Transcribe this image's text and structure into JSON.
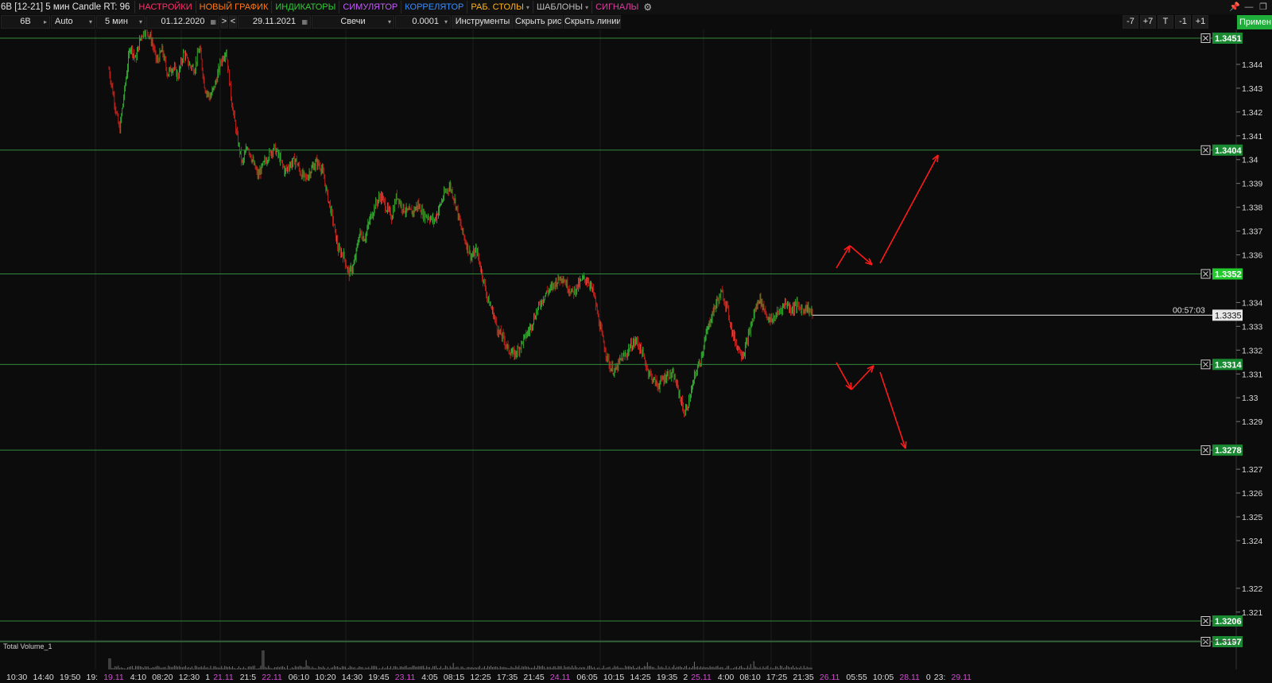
{
  "header": {
    "title": "6B [12-21] 5 мин Candle RT: 96",
    "menus": [
      {
        "label": "НАСТРОЙКИ",
        "color": "#ff2f6e"
      },
      {
        "label": "НОВЫЙ ГРАФИК",
        "color": "#ff7a1a"
      },
      {
        "label": "ИНДИКАТОРЫ",
        "color": "#34c93c"
      },
      {
        "label": "СИМУЛЯТОР",
        "color": "#c65bff"
      },
      {
        "label": "КОРРЕЛЯТОР",
        "color": "#3b8cff"
      },
      {
        "label": "РАБ. СТОЛЫ",
        "color": "#ffb01f"
      },
      {
        "label": "ШАБЛОНЫ",
        "color": "#bdbdbd"
      },
      {
        "label": "СИГНАЛЫ",
        "color": "#e03ea0"
      }
    ],
    "pin_icon": "pin-icon",
    "minimize_icon": "minimize-icon",
    "restore_icon": "restore-icon",
    "settings_icon": "gear-icon"
  },
  "toolbar": {
    "symbol": "6B",
    "scale": "Auto",
    "timeframe": "5 мин",
    "date_from": "01.12.2020",
    "nav_next": ">",
    "nav_prev": "<",
    "date_to": "29.11.2021",
    "chart_type": "Свечи",
    "step": "0.0001",
    "tools_label": "Инструменты",
    "hide_drawings_label": "Скрыть рис.",
    "hide_lines_label": "Скрыть линии",
    "zoom_buttons": [
      "-7",
      "+7",
      "T",
      "-1",
      "+1"
    ],
    "apply_label": "Примен"
  },
  "chart_data": {
    "type": "candlestick",
    "instrument": "6B [12-21]",
    "timeframe": "5 мин",
    "y_range": [
      1.3195,
      1.3455
    ],
    "y_ticks": [
      "1.344",
      "1.343",
      "1.342",
      "1.341",
      "1.34",
      "1.339",
      "1.338",
      "1.337",
      "1.336",
      "1.334",
      "1.333",
      "1.332",
      "1.331",
      "1.33",
      "1.329",
      "1.327",
      "1.326",
      "1.325",
      "1.324",
      "1.322",
      "1.321"
    ],
    "horizontal_levels": [
      {
        "value": 1.3451,
        "label": "1.3451",
        "highlight": false
      },
      {
        "value": 1.3404,
        "label": "1.3404",
        "highlight": false
      },
      {
        "value": 1.3352,
        "label": "1.3352",
        "highlight": true
      },
      {
        "value": 1.3314,
        "label": "1.3314",
        "highlight": false
      },
      {
        "value": 1.3278,
        "label": "1.3278",
        "highlight": false
      },
      {
        "value": 1.3206,
        "label": "1.3206",
        "highlight": false
      },
      {
        "value": 1.3197,
        "label": "1.3197",
        "highlight": false
      }
    ],
    "current_price": {
      "value": 1.3335,
      "label": "1.3335",
      "timer": "00:57:03"
    },
    "price_path": [
      1.3438,
      1.3425,
      1.3412,
      1.343,
      1.3448,
      1.3442,
      1.3452,
      1.3455,
      1.345,
      1.3441,
      1.3446,
      1.3436,
      1.3439,
      1.3435,
      1.3445,
      1.344,
      1.3438,
      1.3447,
      1.343,
      1.3426,
      1.3432,
      1.3441,
      1.3446,
      1.3425,
      1.341,
      1.3398,
      1.3406,
      1.3399,
      1.3393,
      1.3398,
      1.3402,
      1.3405,
      1.3401,
      1.3395,
      1.3398,
      1.34,
      1.3394,
      1.3392,
      1.3396,
      1.3399,
      1.3396,
      1.3385,
      1.3375,
      1.3362,
      1.336,
      1.3352,
      1.3356,
      1.3369,
      1.3367,
      1.3375,
      1.3381,
      1.3385,
      1.338,
      1.3376,
      1.3385,
      1.338,
      1.3378,
      1.3378,
      1.3381,
      1.3377,
      1.3376,
      1.3374,
      1.338,
      1.3386,
      1.3389,
      1.3382,
      1.3372,
      1.3365,
      1.3359,
      1.3362,
      1.3352,
      1.3342,
      1.3336,
      1.3328,
      1.3325,
      1.332,
      1.3318,
      1.3321,
      1.3325,
      1.3329,
      1.3335,
      1.334,
      1.3344,
      1.3346,
      1.3349,
      1.3351,
      1.3347,
      1.3344,
      1.3347,
      1.335,
      1.3349,
      1.3343,
      1.3331,
      1.3321,
      1.3313,
      1.3311,
      1.3316,
      1.3318,
      1.3322,
      1.3324,
      1.3319,
      1.3312,
      1.3308,
      1.3305,
      1.3308,
      1.331,
      1.3309,
      1.3302,
      1.3293,
      1.33,
      1.331,
      1.3316,
      1.3326,
      1.3334,
      1.334,
      1.3344,
      1.3338,
      1.3327,
      1.3321,
      1.3318,
      1.3326,
      1.3335,
      1.3342,
      1.3337,
      1.3332,
      1.3334,
      1.3337,
      1.334,
      1.3337,
      1.3339,
      1.3337,
      1.3338,
      1.3335
    ],
    "volume_panel_label": "Total Volume_1",
    "x_labels": [
      {
        "t": "10:30",
        "h": false
      },
      {
        "t": "14:40",
        "h": false
      },
      {
        "t": "19:50",
        "h": false
      },
      {
        "t": "19:",
        "h": false
      },
      {
        "t": "19.11",
        "h": true
      },
      {
        "t": "4:10",
        "h": false
      },
      {
        "t": "08:20",
        "h": false
      },
      {
        "t": "12:30",
        "h": false
      },
      {
        "t": "1",
        "h": false
      },
      {
        "t": "21.11",
        "h": true
      },
      {
        "t": "21:5",
        "h": false
      },
      {
        "t": "22.11",
        "h": true
      },
      {
        "t": "06:10",
        "h": false
      },
      {
        "t": "10:20",
        "h": false
      },
      {
        "t": "14:30",
        "h": false
      },
      {
        "t": "19:45",
        "h": false
      },
      {
        "t": "23.11",
        "h": true
      },
      {
        "t": "4:05",
        "h": false
      },
      {
        "t": "08:15",
        "h": false
      },
      {
        "t": "12:25",
        "h": false
      },
      {
        "t": "17:35",
        "h": false
      },
      {
        "t": "21:45",
        "h": false
      },
      {
        "t": "24.11",
        "h": true
      },
      {
        "t": "06:05",
        "h": false
      },
      {
        "t": "10:15",
        "h": false
      },
      {
        "t": "14:25",
        "h": false
      },
      {
        "t": "19:35",
        "h": false
      },
      {
        "t": "2",
        "h": false
      },
      {
        "t": "25.11",
        "h": true
      },
      {
        "t": "4:00",
        "h": false
      },
      {
        "t": "08:10",
        "h": false
      },
      {
        "t": "17:25",
        "h": false
      },
      {
        "t": "21:35",
        "h": false
      },
      {
        "t": "26.11",
        "h": true
      },
      {
        "t": "05:55",
        "h": false
      },
      {
        "t": "10:05",
        "h": false
      },
      {
        "t": "28.11",
        "h": true
      },
      {
        "t": "0",
        "h": false
      },
      {
        "t": "23:",
        "h": false
      },
      {
        "t": "29.11",
        "h": true
      }
    ],
    "annotations": "red arrows: breakout scenarios above 1.3352 and below 1.3314"
  },
  "colors": {
    "level_line": "#2f8a3d",
    "label_bg": "#1a8a32",
    "highlight_bg": "#22c92c",
    "up": "#37c837",
    "down": "#e0221c",
    "arrow": "#ff1a1a",
    "date_label": "#d34bd3"
  }
}
